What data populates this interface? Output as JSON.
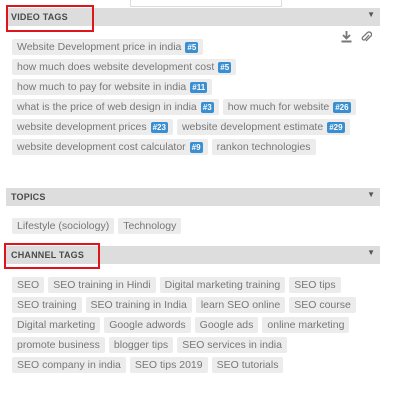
{
  "sections": {
    "video_tags": {
      "title": "VIDEO TAGS",
      "tags": [
        {
          "label": "Website Development price in india",
          "badge": "#5"
        },
        {
          "label": "how much does website development cost",
          "badge": "#5"
        },
        {
          "label": "how much to pay for website in india",
          "badge": "#11"
        },
        {
          "label": "what is the price of web design in india",
          "badge": "#3"
        },
        {
          "label": "how much for website",
          "badge": "#26"
        },
        {
          "label": "website development prices",
          "badge": "#23"
        },
        {
          "label": "website development estimate",
          "badge": "#29"
        },
        {
          "label": "website development cost calculator",
          "badge": "#9"
        },
        {
          "label": "rankon technologies",
          "badge": ""
        }
      ]
    },
    "topics": {
      "title": "TOPICS",
      "tags": [
        {
          "label": "Lifestyle (sociology)",
          "badge": ""
        },
        {
          "label": "Technology",
          "badge": ""
        }
      ]
    },
    "channel_tags": {
      "title": "CHANNEL TAGS",
      "tags": [
        {
          "label": "SEO",
          "badge": ""
        },
        {
          "label": "SEO training in Hindi",
          "badge": ""
        },
        {
          "label": "Digital marketing training",
          "badge": ""
        },
        {
          "label": "SEO tips",
          "badge": ""
        },
        {
          "label": "SEO training",
          "badge": ""
        },
        {
          "label": "SEO training in India",
          "badge": ""
        },
        {
          "label": "learn SEO online",
          "badge": ""
        },
        {
          "label": "SEO course",
          "badge": ""
        },
        {
          "label": "Digital marketing",
          "badge": ""
        },
        {
          "label": "Google adwords",
          "badge": ""
        },
        {
          "label": "Google ads",
          "badge": ""
        },
        {
          "label": "online marketing",
          "badge": ""
        },
        {
          "label": "promote business",
          "badge": ""
        },
        {
          "label": "blogger tips",
          "badge": ""
        },
        {
          "label": "SEO services in india",
          "badge": ""
        },
        {
          "label": "SEO company in india",
          "badge": ""
        },
        {
          "label": "SEO tips 2019",
          "badge": ""
        },
        {
          "label": "SEO tutorials",
          "badge": ""
        }
      ]
    }
  },
  "icons": {
    "collapse": "triangle-down-icon",
    "download": "download-icon",
    "attach": "paperclip-icon"
  },
  "colors": {
    "highlight": "#e0151b",
    "badge": "#3a8fd0",
    "header_bg": "#dddddd",
    "tag_bg": "#ececec"
  }
}
